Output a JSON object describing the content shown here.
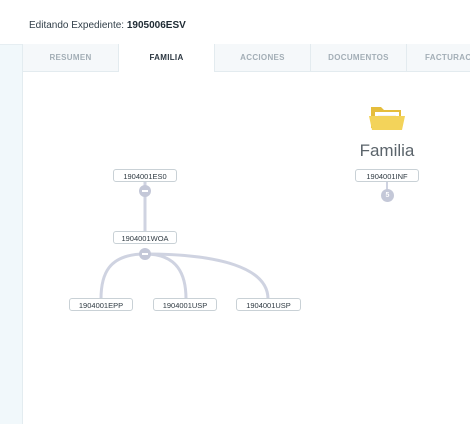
{
  "header": {
    "prefix": "Editando Expediente:",
    "expediente_id": "1905006ESV"
  },
  "tabs": [
    {
      "label": "RESUMEN",
      "active": false
    },
    {
      "label": "FAMILIA",
      "active": true
    },
    {
      "label": "ACCIONES",
      "active": false
    },
    {
      "label": "DOCUMENTOS",
      "active": false
    },
    {
      "label": "FACTURACION",
      "active": false
    }
  ],
  "tree": {
    "root": "1904001ES0",
    "middle": "1904001WOA",
    "children": [
      "1904001EPP",
      "1904001USP",
      "1904001USP"
    ]
  },
  "folder": {
    "icon": "folder-open-icon",
    "title": "Familia",
    "node": "1904001INF",
    "count": "5"
  },
  "colors": {
    "connector": "#cfd3e1",
    "toggle": "#c4c8d8",
    "folder": "#f3d35a",
    "active_tab_text": "#2b3640"
  }
}
